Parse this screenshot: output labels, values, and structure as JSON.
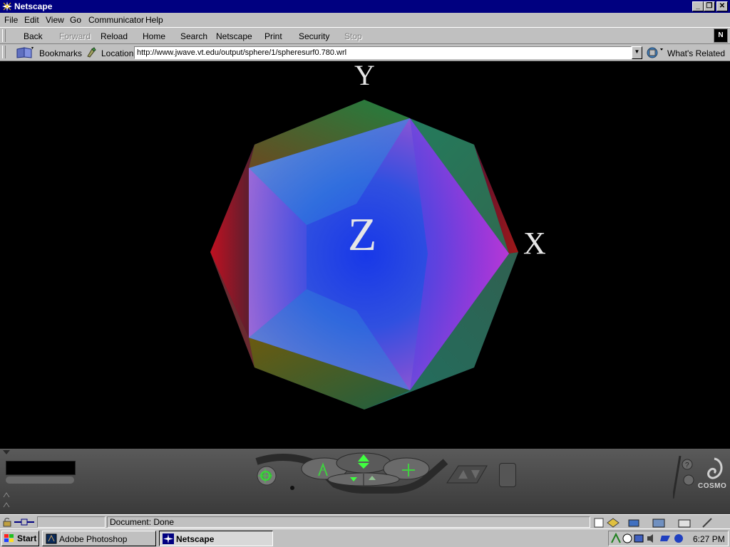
{
  "window": {
    "title": "Netscape"
  },
  "menu": [
    "File",
    "Edit",
    "View",
    "Go",
    "Communicator",
    "Help"
  ],
  "toolbar": {
    "back": "Back",
    "forward": "Forward",
    "reload": "Reload",
    "home": "Home",
    "search": "Search",
    "netscape": "Netscape",
    "print": "Print",
    "security": "Security",
    "stop": "Stop"
  },
  "locationbar": {
    "bookmarks": "Bookmarks",
    "location_label": "Location:",
    "url": "http://www.jwave.vt.edu/output/sphere/1/spheresurf0.780.wrl",
    "whats_related": "What's Related"
  },
  "scene": {
    "axis_y": "Y",
    "axis_z": "Z",
    "axis_x": "X"
  },
  "cosmo": {
    "logo": "COSMO"
  },
  "status": {
    "text": "Document: Done"
  },
  "taskbar": {
    "start": "Start",
    "tasks": [
      "Adobe Photoshop",
      "Netscape"
    ],
    "clock": "6:27 PM"
  }
}
